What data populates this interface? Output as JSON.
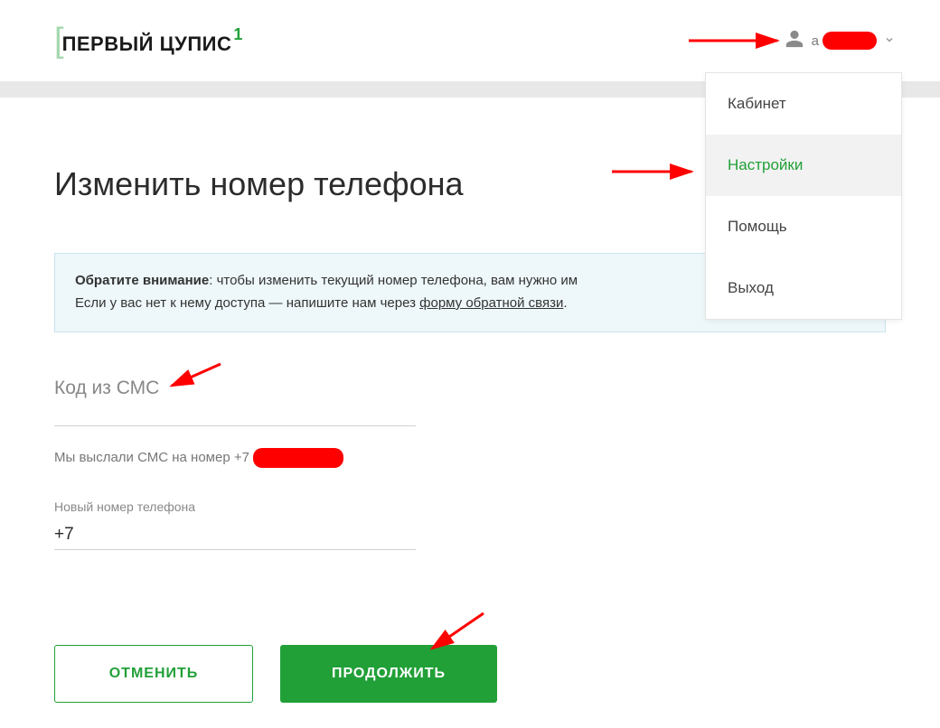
{
  "logo": {
    "text": "ПЕРВЫЙ ЦУПИС",
    "super": "1"
  },
  "user": {
    "letter": "а"
  },
  "dropdown": {
    "items": [
      {
        "label": "Кабинет"
      },
      {
        "label": "Настройки"
      },
      {
        "label": "Помощь"
      },
      {
        "label": "Выход"
      }
    ]
  },
  "page": {
    "title": "Изменить номер телефона"
  },
  "notice": {
    "bold": "Обратите внимание",
    "text1": ": чтобы изменить текущий номер телефона, вам нужно им",
    "text2": "Если у вас нет к нему доступа — напишите нам через ",
    "link": "форму обратной связи",
    "after": "."
  },
  "sms": {
    "label": "Код из СМС",
    "sent_prefix": "Мы выслали СМС на номер +7"
  },
  "new_phone": {
    "label": "Новый номер телефона",
    "value": "+7"
  },
  "buttons": {
    "cancel": "ОТМЕНИТЬ",
    "continue": "ПРОДОЛЖИТЬ"
  }
}
